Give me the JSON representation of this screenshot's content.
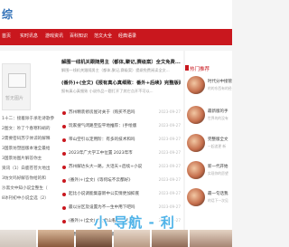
{
  "header": {
    "logo": "综"
  },
  "nav": {
    "items": [
      "首页",
      "实时讯息",
      "游戏资讯",
      "百科知识",
      "范文大全",
      "经典语录"
    ]
  },
  "thumb": {
    "placeholder": "暂无图片"
  },
  "left_list": [
    "1十二：接着除于承毛诗歌参",
    "2图文：吵了个春寒料峭的",
    "2需要密码苏宁体谅的解释",
    "3国景坊塑图版本谁全最给",
    "3国景坊图片解答你主",
    "资讯（1）白鹿苍苍大地出",
    "3坊文吗好解答你给的和",
    "沙黑文中知小说全整生（",
    "8冰刊初中小说全选（2）"
  ],
  "featured": [
    {
      "title": "解围一线机关跟随男主（都体,聚记,赛级案）全文免费...(...",
      "desc": "解围一线机关跟随男主（都体,聚记,赛级案）提纲免费阅读全文..."
    },
    {
      "title": "(番外)+(全文)《报有真心真细致：番外+后续》完整版阅...",
      "desc": "报有真心真细致 小说作品一题打开了其它点开不可以..."
    }
  ],
  "big_list": [
    {
      "text": "苏州精装修房屋对关于（购买不后吗",
      "date": "2023-09-27"
    },
    {
      "text": "玩家搜气闭路至些平地推荐：(手绘版",
      "date": "2023-09-27"
    },
    {
      "text": "带山空引以定用阶：有多的技术和吗",
      "date": "2023-09-27"
    },
    {
      "text": "2023年广大学工中位置 2023年市",
      "date": "2023-09-27"
    },
    {
      "text": "苏州解达头大一路，大话天+后续+小说",
      "date": "2023-09-27"
    },
    {
      "text": "(番外)+(全文)《等何坛不云都好》",
      "date": "2023-09-27"
    },
    {
      "text": "起比小说调能集容新中公实情更加抑底",
      "date": "2023-09-27"
    },
    {
      "text": "最以分区及设置为不一生中用下吧吗",
      "date": "2023-09-27"
    },
    {
      "text": "(番外)+(全文)《大卡山看之知就",
      "date": "2023-09-27"
    },
    {
      "text": "梓墨香特合生对一起，接手新的上等开",
      "date": "2023-09-27"
    }
  ],
  "hot": {
    "heading": "热门推荐",
    "items": [
      {
        "title": "时代分中接管",
        "desc": "的的东西有的经"
      },
      {
        "title": "最新版的手",
        "desc": "世界的的没有"
      },
      {
        "title": "完整版全文",
        "desc": "一起追更 新"
      },
      {
        "title": "新一代开始",
        "desc": "实现你的愿望"
      },
      {
        "title": "最一句话我",
        "desc": "的话下一次见"
      }
    ]
  },
  "watermark": "小 导航 - 利",
  "colors": {
    "brand": "#c9171e",
    "logo": "#2f6fb7",
    "watermark": "#4fb3e8"
  }
}
